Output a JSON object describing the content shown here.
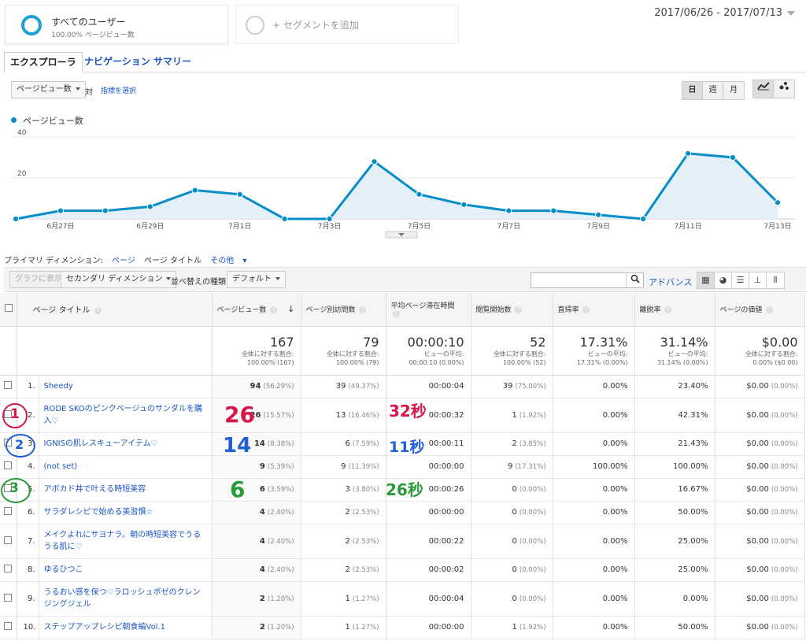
{
  "segments": {
    "primary": {
      "title": "すべてのユーザー",
      "subtitle": "100.00% ページビュー数"
    },
    "add_label": "+ セグメントを追加"
  },
  "date_range": "2017/06/26 - 2017/07/13",
  "tabs": [
    "エクスプローラ",
    "ナビゲーション サマリー"
  ],
  "metric_select": {
    "value": "ページビュー数",
    "vs": "対",
    "choose_metric": "指標を選択"
  },
  "granularity": {
    "day": "日",
    "week": "週",
    "month": "月"
  },
  "legend": "ページビュー数",
  "chart_data": {
    "type": "area",
    "series": [
      {
        "name": "ページビュー数",
        "values": [
          0,
          4,
          4,
          6,
          14,
          12,
          0,
          0,
          28,
          12,
          7,
          4,
          4,
          2,
          0,
          32,
          30,
          8
        ]
      }
    ],
    "x": [
      "6/26",
      "6/27",
      "6/28",
      "6/29",
      "6/30",
      "7/1",
      "7/2",
      "7/3",
      "7/4",
      "7/5",
      "7/6",
      "7/7",
      "7/8",
      "7/9",
      "7/10",
      "7/11",
      "7/12",
      "7/13"
    ],
    "xticks": [
      "6月27日",
      "6月29日",
      "7月1日",
      "7月3日",
      "7月5日",
      "7月7日",
      "7月9日",
      "7月11日",
      "7月13日"
    ],
    "yticks": [
      "20",
      "40"
    ],
    "ylim": [
      0,
      40
    ],
    "color": "#058dc7"
  },
  "dimension": {
    "label": "プライマリ ディメンション:",
    "options": [
      "ページ",
      "ページ タイトル",
      "その他"
    ]
  },
  "toolbar": {
    "graph": "グラフに表示",
    "secondary": "セカンダリ ディメンション",
    "sort_label": "並べ替えの種類:",
    "sort_value": "デフォルト",
    "advanced": "アドバンス"
  },
  "columns": [
    "ページ タイトル",
    "ページビュー数",
    "ページ別訪問数",
    "平均ページ滞在時間",
    "閲覧開始数",
    "直帰率",
    "離脱率",
    "ページの価値"
  ],
  "totals": [
    {
      "value": "167",
      "note1": "全体に対する割合:",
      "note2": "100.00% (167)"
    },
    {
      "value": "79",
      "note1": "全体に対する割合:",
      "note2": "100.00% (79)"
    },
    {
      "value": "00:00:10",
      "note1": "ビューの平均:",
      "note2": "00:00:10 (0.00%)"
    },
    {
      "value": "52",
      "note1": "全体に対する割合:",
      "note2": "100.00% (52)"
    },
    {
      "value": "17.31%",
      "note1": "ビューの平均:",
      "note2": "17.31% (0.00%)"
    },
    {
      "value": "31.14%",
      "note1": "ビューの平均:",
      "note2": "31.14% (0.00%)"
    },
    {
      "value": "$0.00",
      "note1": "全体に対する割合:",
      "note2": "0.00% ($0.00)"
    }
  ],
  "rows": [
    {
      "idx": "1.",
      "title": "Sheedy",
      "pv": "94",
      "pvp": "(56.29%)",
      "visits": "39",
      "vp": "(49.37%)",
      "time": "00:00:04",
      "entr": "39",
      "ep": "(75.00%)",
      "bounce": "0.00%",
      "exit": "23.40%",
      "val": "$0.00",
      "valp": "(0.00%)"
    },
    {
      "idx": "2.",
      "title": "RODE SKOのピンクベージュのサンダルを購入♡",
      "pv": "26",
      "pvp": "(15.57%)",
      "visits": "13",
      "vp": "(16.46%)",
      "time": "00:00:32",
      "entr": "1",
      "ep": "(1.92%)",
      "bounce": "0.00%",
      "exit": "42.31%",
      "val": "$0.00",
      "valp": "(0.00%)",
      "tall": true
    },
    {
      "idx": "3.",
      "title": "IGNISの肌レスキューアイテム♡",
      "pv": "14",
      "pvp": "(8.38%)",
      "visits": "6",
      "vp": "(7.59%)",
      "time": "00:00:11",
      "entr": "2",
      "ep": "(3.85%)",
      "bounce": "0.00%",
      "exit": "21.43%",
      "val": "$0.00",
      "valp": "(0.00%)"
    },
    {
      "idx": "4.",
      "title": "(not set)",
      "pv": "9",
      "pvp": "(5.39%)",
      "visits": "9",
      "vp": "(11.39%)",
      "time": "00:00:00",
      "entr": "9",
      "ep": "(17.31%)",
      "bounce": "100.00%",
      "exit": "100.00%",
      "val": "$0.00",
      "valp": "(0.00%)"
    },
    {
      "idx": "5.",
      "title": "アボカド丼で叶える時短美容",
      "pv": "6",
      "pvp": "(3.59%)",
      "visits": "3",
      "vp": "(3.80%)",
      "time": "00:00:26",
      "entr": "0",
      "ep": "(0.00%)",
      "bounce": "0.00%",
      "exit": "16.67%",
      "val": "$0.00",
      "valp": "(0.00%)"
    },
    {
      "idx": "6.",
      "title": "サラダレシピで始める美習慣☆",
      "pv": "4",
      "pvp": "(2.40%)",
      "visits": "2",
      "vp": "(2.53%)",
      "time": "00:00:00",
      "entr": "0",
      "ep": "(0.00%)",
      "bounce": "0.00%",
      "exit": "50.00%",
      "val": "$0.00",
      "valp": "(0.00%)"
    },
    {
      "idx": "7.",
      "title": "メイクよれにサヨナラ。朝の時短美容でうるうる肌に♡",
      "pv": "4",
      "pvp": "(2.40%)",
      "visits": "2",
      "vp": "(2.53%)",
      "time": "00:00:22",
      "entr": "0",
      "ep": "(0.00%)",
      "bounce": "0.00%",
      "exit": "25.00%",
      "val": "$0.00",
      "valp": "(0.00%)",
      "tall": true
    },
    {
      "idx": "8.",
      "title": "ゆるひつこ",
      "pv": "4",
      "pvp": "(2.40%)",
      "visits": "2",
      "vp": "(2.53%)",
      "time": "00:00:02",
      "entr": "0",
      "ep": "(0.00%)",
      "bounce": "0.00%",
      "exit": "25.00%",
      "val": "$0.00",
      "valp": "(0.00%)"
    },
    {
      "idx": "9.",
      "title": "うるおい感を保つ♡ラロッシュポゼのクレンジングジェル",
      "pv": "2",
      "pvp": "(1.20%)",
      "visits": "1",
      "vp": "(1.27%)",
      "time": "00:00:04",
      "entr": "0",
      "ep": "(0.00%)",
      "bounce": "0.00%",
      "exit": "0.00%",
      "val": "$0.00",
      "valp": "(0.00%)",
      "tall": true
    },
    {
      "idx": "10.",
      "title": "ステップアップレシピ朝食編Vol.1",
      "pv": "2",
      "pvp": "(1.20%)",
      "visits": "1",
      "vp": "(1.27%)",
      "time": "00:00:00",
      "entr": "1",
      "ep": "(1.92%)",
      "bounce": "0.00%",
      "exit": "50.00%",
      "val": "$0.00",
      "valp": "(0.00%)"
    }
  ],
  "annotations": {
    "red_num": "26",
    "red_time": "32秒",
    "red_circle": "1",
    "blue_num": "14",
    "blue_time": "11秒",
    "blue_circle": "2",
    "green_num": "6",
    "green_time": "26秒",
    "green_circle": "3",
    "colors": {
      "red": "#d4184a",
      "blue": "#1f5fd8",
      "green": "#2a9a3a"
    }
  }
}
